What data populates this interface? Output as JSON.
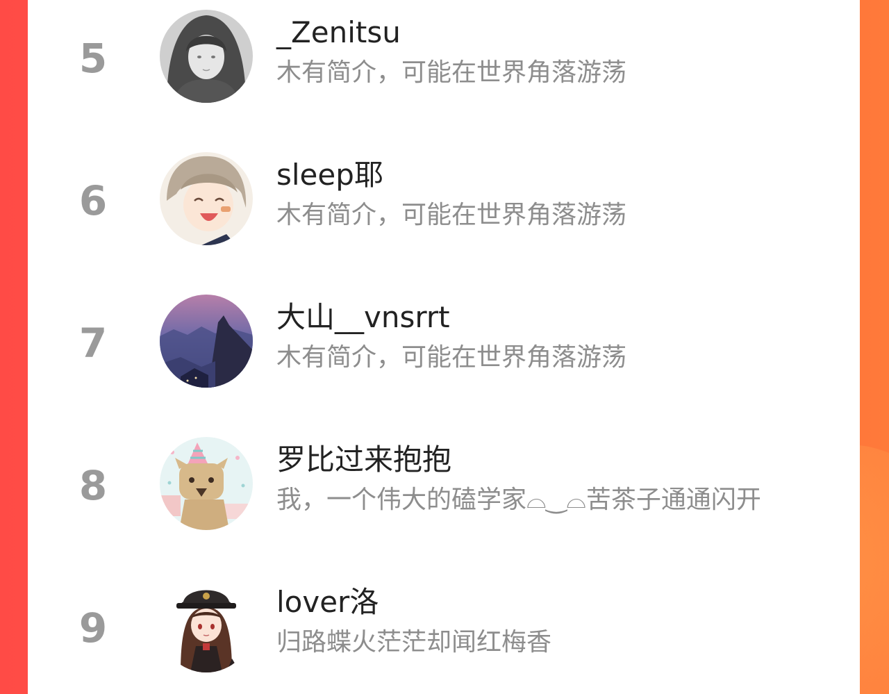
{
  "colors": {
    "background_left": "#ff4b46",
    "background_right": "#ff7a3a",
    "card": "#ffffff",
    "rank_text": "#9a9a9a",
    "name_text": "#222222",
    "desc_text": "#8d8d8d"
  },
  "ranking": [
    {
      "rank": "5",
      "name": "_Zenitsu",
      "description": "木有简介，可能在世界角落游荡",
      "avatar_icon": "grayscale-anime-girl-avatar"
    },
    {
      "rank": "6",
      "name": "sleep耶",
      "description": "木有简介，可能在世界角落游荡",
      "avatar_icon": "smiling-anime-boy-avatar"
    },
    {
      "rank": "7",
      "name": "大山__vnsrrt",
      "description": "木有简介，可能在世界角落游荡",
      "avatar_icon": "mountain-landscape-avatar"
    },
    {
      "rank": "8",
      "name": "罗比过来抱抱",
      "description": "我，一个伟大的磕学家⌓‿⌓苦茶子通通闪开",
      "avatar_icon": "party-hat-cat-avatar"
    },
    {
      "rank": "9",
      "name": "lover洛",
      "description": "归路蝶火茫茫却闻红梅香",
      "avatar_icon": "anime-girl-hat-avatar"
    }
  ]
}
